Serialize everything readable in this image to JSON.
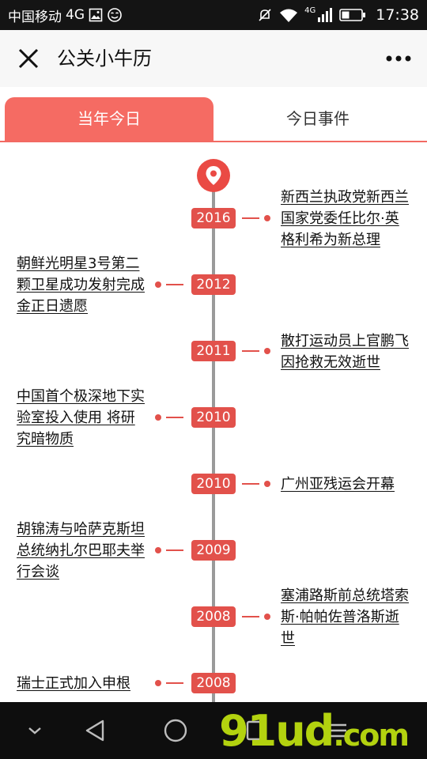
{
  "status_bar": {
    "carrier": "中国移动",
    "network": "4G",
    "signal_network": "4G",
    "time": "17:38",
    "icons": [
      "image-icon",
      "face-icon",
      "mute-icon",
      "wifi-icon",
      "signal-icon",
      "battery-icon"
    ]
  },
  "title_bar": {
    "title": "公关小牛历",
    "close_icon": "close-icon",
    "more_icon": "more-icon"
  },
  "tabs": [
    {
      "label": "当年今日",
      "active": true
    },
    {
      "label": "今日事件",
      "active": false
    }
  ],
  "timeline": {
    "pin_icon": "location-pin-icon",
    "events": [
      {
        "year": "2016",
        "side": "right",
        "text": "新西兰执政党新西兰国家党委任比尔·英格利希为新总理"
      },
      {
        "year": "2012",
        "side": "left",
        "text": "朝鲜光明星3号第二颗卫星成功发射完成金正日遗愿"
      },
      {
        "year": "2011",
        "side": "right",
        "text": "散打运动员上官鹏飞因抢救无效逝世"
      },
      {
        "year": "2010",
        "side": "left",
        "text": "中国首个极深地下实验室投入使用 将研究暗物质"
      },
      {
        "year": "2010",
        "side": "right",
        "text": "广州亚残运会开幕"
      },
      {
        "year": "2009",
        "side": "left",
        "text": "胡锦涛与哈萨克斯坦总统纳扎尔巴耶夫举行会谈"
      },
      {
        "year": "2008",
        "side": "right",
        "text": "塞浦路斯前总统塔索斯·帕帕佐普洛斯逝世"
      },
      {
        "year": "2008",
        "side": "left",
        "text": "瑞士正式加入申根"
      }
    ]
  },
  "nav_bar": {
    "buttons": [
      "collapse-icon",
      "back-icon",
      "home-icon",
      "recents-icon",
      "menu-icon"
    ],
    "watermark": "91ud",
    "watermark_suffix": ".com"
  },
  "colors": {
    "accent": "#f56b63",
    "timeline_red": "#e2514b",
    "line_gray": "#9a9a9a",
    "status_bg": "#141414",
    "nav_bg": "#0e0e0e",
    "watermark": "#b3d20f"
  }
}
